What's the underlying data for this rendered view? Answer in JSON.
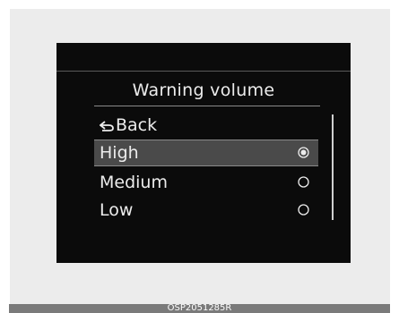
{
  "menu": {
    "title": "Warning volume",
    "back_label": "Back",
    "items": [
      {
        "label": "High",
        "selected": true
      },
      {
        "label": "Medium",
        "selected": false
      },
      {
        "label": "Low",
        "selected": false
      }
    ]
  },
  "footer": {
    "code": "OSP2051285R"
  },
  "colors": {
    "screen_background": "#0b0b0b",
    "selected_row": "#4a4a4a",
    "text": "#ececec"
  },
  "icons": {
    "back": "back-arrow-icon",
    "selected": "radio-selected-icon",
    "unselected": "radio-unselected-icon"
  }
}
